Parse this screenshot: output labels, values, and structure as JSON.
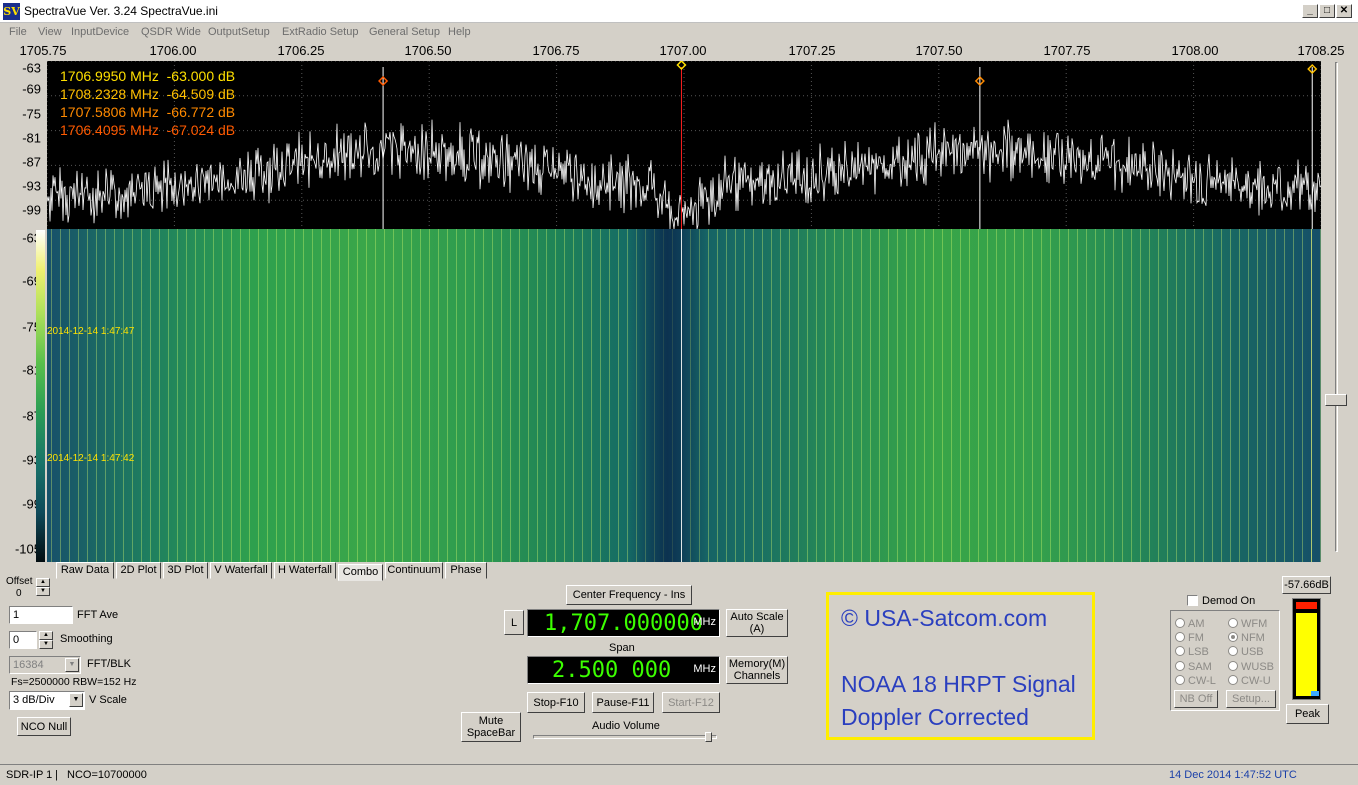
{
  "window": {
    "title": "SpectraVue Ver. 3.24  SpectraVue.ini",
    "icon_text": "SV",
    "minimize": "_",
    "maximize": "□",
    "close": "✕"
  },
  "menu": [
    "File",
    "View",
    "InputDevice",
    "QSDR Wide",
    "OutputSetup",
    "ExtRadio Setup",
    "General Setup",
    "Help"
  ],
  "freq_axis": [
    "1705.75",
    "1706.00",
    "1706.25",
    "1706.50",
    "1706.75",
    "1707.00",
    "1707.25",
    "1707.50",
    "1707.75",
    "1708.00",
    "1708.25"
  ],
  "db_scale_spectrum": [
    "-63",
    "-69",
    "-75",
    "-81",
    "-87",
    "-93",
    "-99"
  ],
  "db_scale_waterfall": [
    "-63",
    "-69",
    "-75",
    "-81",
    "-87",
    "-93",
    "-99",
    "-105"
  ],
  "markers": [
    {
      "text": "1706.9950 MHz  -63.000 dB",
      "color": "#ffe000"
    },
    {
      "text": "1708.2328 MHz  -64.509 dB",
      "color": "#ffc000"
    },
    {
      "text": "1707.5806 MHz  -66.772 dB",
      "color": "#ff8a00"
    },
    {
      "text": "1706.4095 MHz  -67.024 dB",
      "color": "#ff5a00"
    }
  ],
  "marker_freqs_mhz": [
    1706.995,
    1708.2328,
    1707.5806,
    1706.4095
  ],
  "waterfall": {
    "timestamps": [
      "2014-12-14 1:47:47",
      "2014-12-14 1:47:42"
    ]
  },
  "tabs": [
    "Raw Data",
    "2D Plot",
    "3D Plot",
    "V Waterfall",
    "H Waterfall",
    "Combo",
    "Continuum",
    "Phase"
  ],
  "active_tab": "Combo",
  "controls": {
    "offset_label": "Offset",
    "offset_value": "0",
    "fft_ave_value": "1",
    "fft_ave_label": "FFT Ave",
    "smoothing_value": "0",
    "smoothing_label": "Smoothing",
    "fft_blk_value": "16384",
    "fft_blk_label": "FFT/BLK",
    "fs_rbw": "Fs=2500000 RBW=152 Hz",
    "vscale_value": "3 dB/Div",
    "vscale_label": "V Scale",
    "nco_null": "NCO Null",
    "center_freq_button": "Center Frequency - Ins",
    "l_button": "L",
    "center_freq_value": "1,707.000000",
    "center_freq_unit": "MHz",
    "auto_scale": "Auto Scale (A)",
    "span_label": "Span",
    "span_value": "2.500 000",
    "span_unit": "MHz",
    "memory_channels": "Memory(M) Channels",
    "stop": "Stop-F10",
    "pause": "Pause-F11",
    "start": "Start-F12",
    "mute": "Mute SpaceBar",
    "audio_volume_label": "Audio Volume",
    "audio_volume_level": 0.97
  },
  "watermark": {
    "line1": "© USA-Satcom.com",
    "line2": "NOAA 18 HRPT Signal",
    "line3": "Doppler Corrected"
  },
  "demod": {
    "demod_on_label": "Demod On",
    "modes_left": [
      "AM",
      "FM",
      "LSB",
      "SAM",
      "CW-L"
    ],
    "modes_right": [
      "WFM",
      "NFM",
      "USB",
      "WUSB",
      "CW-U"
    ],
    "selected": "NFM",
    "nb_off": "NB Off",
    "setup": "Setup..."
  },
  "meter": {
    "readout": "-57.66dB",
    "peak_button": "Peak",
    "level": 0.88
  },
  "status": {
    "device": "SDR-IP 1",
    "separator": "|",
    "nco": "NCO=10700000",
    "datetime": "14 Dec 2014  1:47:52 UTC"
  },
  "colors": {
    "spectrum_trace": "#ffffff",
    "lcd_digits": "#3cff00",
    "watermark_text": "#2a3fbf",
    "watermark_border": "#ffee00",
    "status_datetime": "#1a3fa8"
  }
}
